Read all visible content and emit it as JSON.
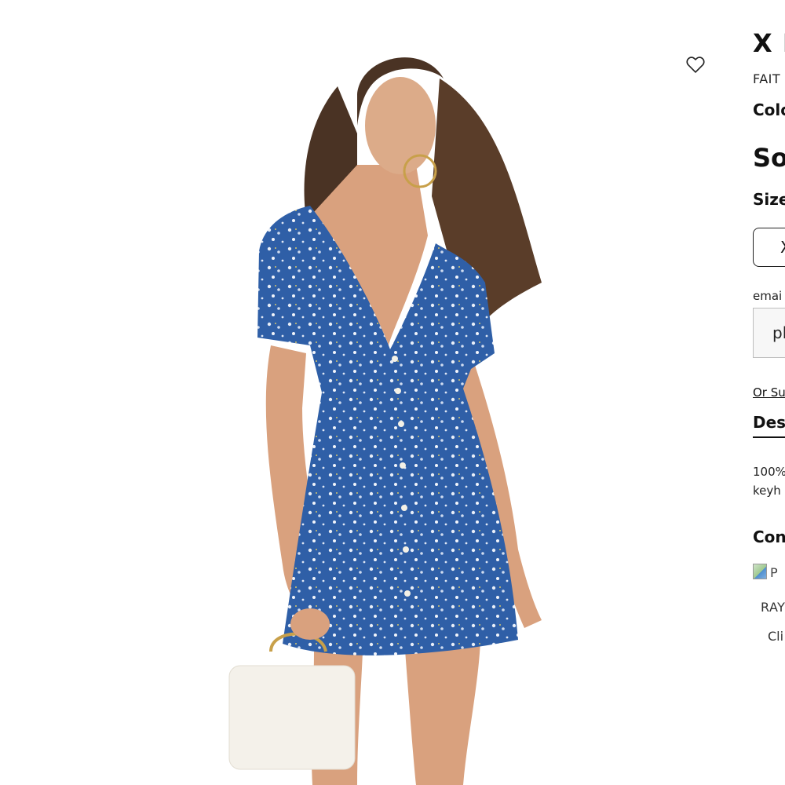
{
  "product": {
    "title": "X I",
    "brand": "FAIT",
    "color_label": "Colo",
    "status": "So",
    "size_label": "Size",
    "size_option": "X"
  },
  "notify": {
    "email_label": "emai",
    "email_placeholder": "pl",
    "subscribe_link": "Or Su"
  },
  "details": {
    "tab_label": "Des",
    "description_line1": "100%",
    "description_line2": "keyh"
  },
  "related": {
    "heading": "Con",
    "image_alt": "P",
    "brand": "RAY",
    "name": "Cli"
  },
  "icons": {
    "wishlist": "heart-outline-icon",
    "broken_image": "broken-image-icon"
  },
  "colors": {
    "dress": "#2f5fa7",
    "background": "#ffffff",
    "text": "#111111"
  }
}
